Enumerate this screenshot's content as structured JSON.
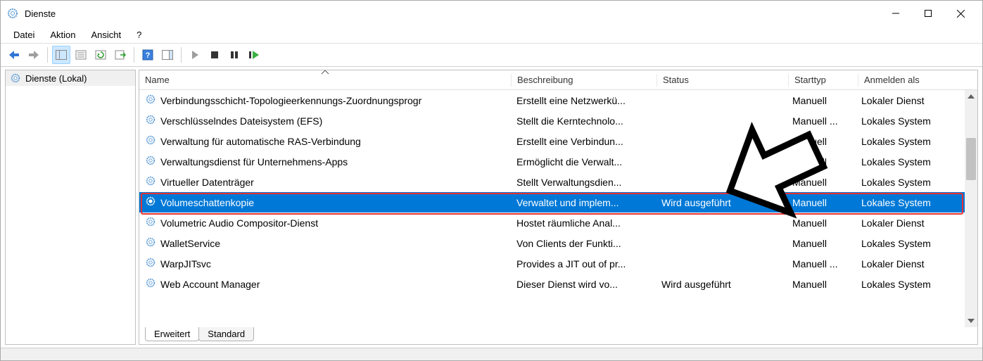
{
  "window": {
    "title": "Dienste"
  },
  "menu": {
    "file": "Datei",
    "action": "Aktion",
    "view": "Ansicht",
    "help": "?"
  },
  "sidebar": {
    "root": "Dienste (Lokal)"
  },
  "columns": {
    "name": "Name",
    "desc": "Beschreibung",
    "status": "Status",
    "start": "Starttyp",
    "login": "Anmelden als"
  },
  "tabs": {
    "extended": "Erweitert",
    "standard": "Standard"
  },
  "services": [
    {
      "name": "Verbindungsschicht-Topologieerkennungs-Zuordnungsprogr",
      "desc": "Erstellt eine Netzwerkü...",
      "status": "",
      "start": "Manuell",
      "login": "Lokaler Dienst",
      "selected": false
    },
    {
      "name": "Verschlüsselndes Dateisystem (EFS)",
      "desc": "Stellt die Kerntechnolo...",
      "status": "",
      "start": "Manuell ...",
      "login": "Lokales System",
      "selected": false
    },
    {
      "name": "Verwaltung für automatische RAS-Verbindung",
      "desc": "Erstellt eine Verbindun...",
      "status": "",
      "start": "Manuell",
      "login": "Lokales System",
      "selected": false
    },
    {
      "name": "Verwaltungsdienst für Unternehmens-Apps",
      "desc": "Ermöglicht die Verwalt...",
      "status": "",
      "start": "Manuell",
      "login": "Lokales System",
      "selected": false
    },
    {
      "name": "Virtueller Datenträger",
      "desc": "Stellt Verwaltungsdien...",
      "status": "",
      "start": "Manuell",
      "login": "Lokales System",
      "selected": false
    },
    {
      "name": "Volumeschattenkopie",
      "desc": "Verwaltet und implem...",
      "status": "Wird ausgeführt",
      "start": "Manuell",
      "login": "Lokales System",
      "selected": true
    },
    {
      "name": "Volumetric Audio Compositor-Dienst",
      "desc": "Hostet räumliche Anal...",
      "status": "",
      "start": "Manuell",
      "login": "Lokaler Dienst",
      "selected": false
    },
    {
      "name": "WalletService",
      "desc": "Von Clients der Funkti...",
      "status": "",
      "start": "Manuell",
      "login": "Lokales System",
      "selected": false
    },
    {
      "name": "WarpJITsvc",
      "desc": "Provides a JIT out of pr...",
      "status": "",
      "start": "Manuell ...",
      "login": "Lokaler Dienst",
      "selected": false
    },
    {
      "name": "Web Account Manager",
      "desc": "Dieser Dienst wird vo...",
      "status": "Wird ausgeführt",
      "start": "Manuell",
      "login": "Lokales System",
      "selected": false
    }
  ]
}
